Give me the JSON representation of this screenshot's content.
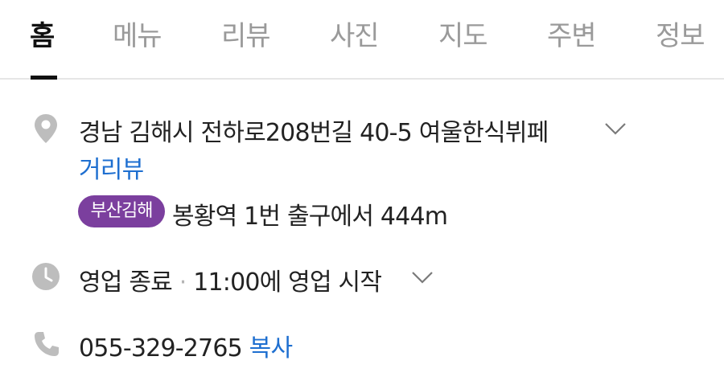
{
  "tabs": [
    {
      "label": "홈",
      "active": true
    },
    {
      "label": "메뉴",
      "active": false
    },
    {
      "label": "리뷰",
      "active": false
    },
    {
      "label": "사진",
      "active": false
    },
    {
      "label": "지도",
      "active": false
    },
    {
      "label": "주변",
      "active": false
    },
    {
      "label": "정보",
      "active": false
    }
  ],
  "address": {
    "icon": "location-pin-icon",
    "text": "경남 김해시 전하로208번길 40-5 여울한식뷔페",
    "street_view_label": "거리뷰"
  },
  "subway": {
    "line_badge": "부산김해",
    "badge_color": "#7b3f9e",
    "text": "봉황역 1번 출구에서 444m"
  },
  "hours": {
    "icon": "clock-icon",
    "status": "영업 종료",
    "separator": "·",
    "next": "11:00에 영업 시작"
  },
  "phone": {
    "icon": "phone-icon",
    "number": "055-329-2765",
    "copy_label": "복사"
  },
  "colors": {
    "link": "#1e6fd0",
    "icon": "#bdbdbd",
    "text": "#222222",
    "tab_inactive": "#9a9a9a"
  }
}
